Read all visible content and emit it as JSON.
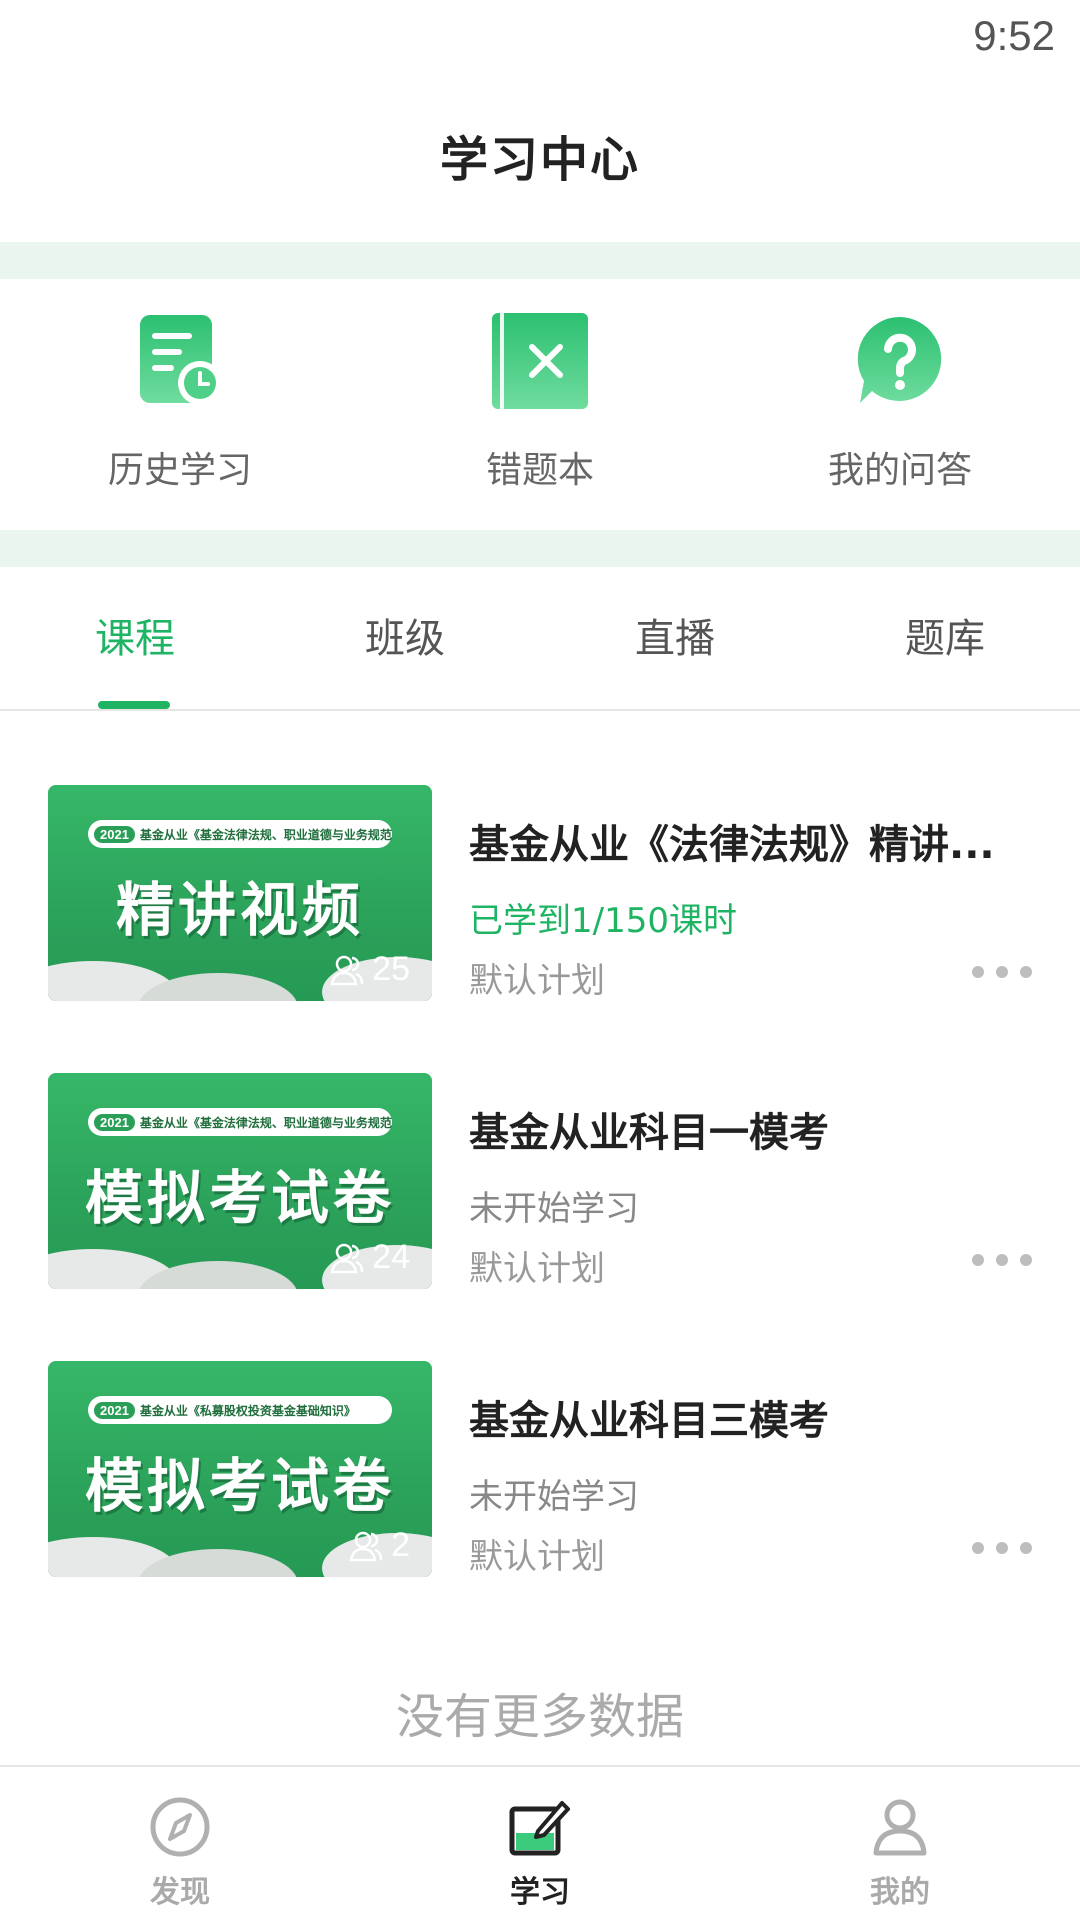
{
  "status": {
    "time": "9:52"
  },
  "header": {
    "title": "学习中心"
  },
  "quick_links": [
    {
      "label": "历史学习",
      "icon": "history-icon"
    },
    {
      "label": "错题本",
      "icon": "wrong-book-icon"
    },
    {
      "label": "我的问答",
      "icon": "question-icon"
    }
  ],
  "tabs": [
    {
      "label": "课程",
      "active": true
    },
    {
      "label": "班级",
      "active": false
    },
    {
      "label": "直播",
      "active": false
    },
    {
      "label": "题库",
      "active": false
    }
  ],
  "courses": [
    {
      "thumb_year": "2021",
      "thumb_subtitle": "基金从业《基金法律法规、职业道德与业务规范》",
      "thumb_title": "精讲视频",
      "students": "25",
      "title": "基金从业《法律法规》精讲...",
      "progress": "已学到1/150课时",
      "plan": "默认计划"
    },
    {
      "thumb_year": "2021",
      "thumb_subtitle": "基金从业《基金法律法规、职业道德与业务规范》",
      "thumb_title": "模拟考试卷",
      "students": "24",
      "title": "基金从业科目一模考",
      "progress": "未开始学习",
      "plan": "默认计划"
    },
    {
      "thumb_year": "2021",
      "thumb_subtitle": "基金从业《私募股权投资基金基础知识》",
      "thumb_title": "模拟考试卷",
      "students": "2",
      "title": "基金从业科目三模考",
      "progress": "未开始学习",
      "plan": "默认计划"
    }
  ],
  "list_footer": "没有更多数据",
  "bottom_nav": [
    {
      "label": "发现",
      "icon": "compass-icon",
      "active": false
    },
    {
      "label": "学习",
      "icon": "study-icon",
      "active": true
    },
    {
      "label": "我的",
      "icon": "profile-icon",
      "active": false
    }
  ],
  "colors": {
    "accent": "#1fb463",
    "band": "#ebf5ef",
    "thumb_green": "#2eaa5e"
  }
}
